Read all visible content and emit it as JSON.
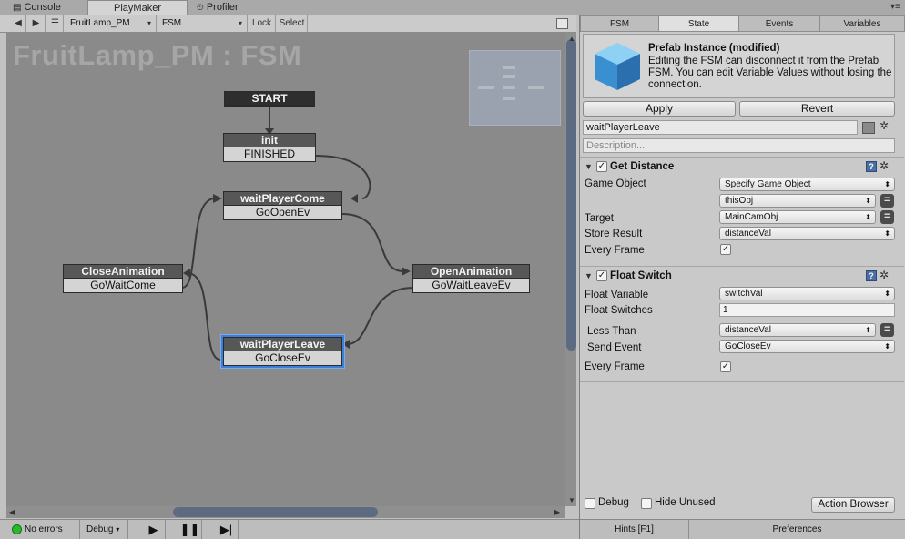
{
  "editor_tabs": [
    {
      "label": "Console",
      "icon": "console-icon"
    },
    {
      "label": "PlayMaker",
      "icon": ""
    },
    {
      "label": "Profiler",
      "icon": "profiler-icon"
    }
  ],
  "toolbar": {
    "fsm_owner": "FruitLamp_PM",
    "fsm_name": "FSM",
    "lock_label": "Lock",
    "select_label": "Select"
  },
  "graph": {
    "title": "FruitLamp_PM : FSM",
    "states": [
      {
        "name": "START",
        "events": []
      },
      {
        "name": "init",
        "events": [
          "FINISHED"
        ]
      },
      {
        "name": "waitPlayerCome",
        "events": [
          "GoOpenEv"
        ]
      },
      {
        "name": "CloseAnimation",
        "events": [
          "GoWaitCome"
        ]
      },
      {
        "name": "OpenAnimation",
        "events": [
          "GoWaitLeaveEv"
        ]
      },
      {
        "name": "waitPlayerLeave",
        "events": [
          "GoCloseEv"
        ],
        "selected": true
      }
    ],
    "selection_color": "#3d7fd6"
  },
  "status_bar": {
    "errors": "No errors",
    "debug": "Debug",
    "ok_color": "#2db52d"
  },
  "inspector": {
    "tabs": [
      "FSM",
      "State",
      "Events",
      "Variables"
    ],
    "active_tab": "State",
    "prefab": {
      "title": "Prefab Instance (modified)",
      "message": "Editing the FSM can disconnect it from the Prefab FSM. You can edit Variable Values without losing the connection.",
      "apply_label": "Apply",
      "revert_label": "Revert"
    },
    "state_name": "waitPlayerLeave",
    "description_placeholder": "Description...",
    "actions": [
      {
        "title": "Get Distance",
        "enabled": true,
        "fields": [
          {
            "label": "Game Object",
            "value": "Specify Game Object"
          },
          {
            "label": "",
            "value": "thisObj"
          },
          {
            "label": "Target",
            "value": "MainCamObj"
          },
          {
            "label": "Store Result",
            "value": "distanceVal"
          },
          {
            "label": "Every Frame",
            "checked": true
          }
        ]
      },
      {
        "title": "Float Switch",
        "enabled": true,
        "fields": [
          {
            "label": "Float Variable",
            "value": "switchVal"
          },
          {
            "label": "Float Switches",
            "value": "1"
          },
          {
            "label": "Less Than",
            "value": "distanceVal"
          },
          {
            "label": "Send Event",
            "value": "GoCloseEv"
          },
          {
            "label": "Every Frame",
            "checked": true
          }
        ]
      }
    ],
    "debug_label": "Debug",
    "hide_unused_label": "Hide Unused",
    "action_browser_label": "Action Browser",
    "hints_label": "Hints [F1]",
    "preferences_label": "Preferences"
  }
}
